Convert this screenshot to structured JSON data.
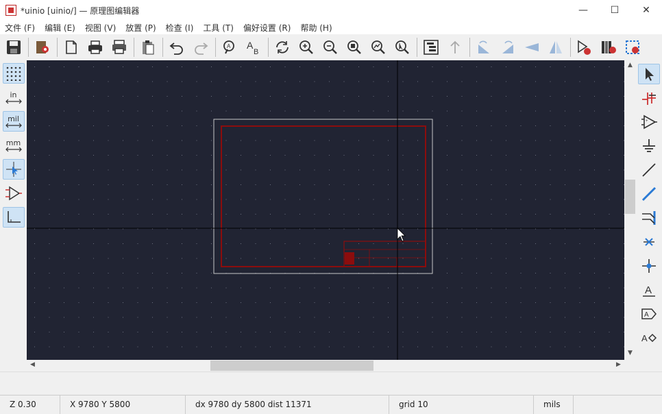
{
  "window": {
    "title": "*uinio [uinio/] — 原理图编辑器",
    "minimize_symbol": "—",
    "maximize_symbol": "☐",
    "close_symbol": "✕"
  },
  "menu": [
    "文件 (F)",
    "编辑 (E)",
    "视图 (V)",
    "放置 (P)",
    "检查 (I)",
    "工具 (T)",
    "偏好设置 (R)",
    "帮助 (H)"
  ],
  "toolbar": {
    "icons": [
      "save-icon",
      "schematic-setup-icon",
      "page-settings-icon",
      "print-icon",
      "plot-icon",
      "paste-icon",
      "undo-icon",
      "redo-icon",
      "find-icon",
      "find-replace-icon",
      "refresh-icon",
      "zoom-in-icon",
      "zoom-out-icon",
      "zoom-fit-icon",
      "zoom-objects-icon",
      "zoom-selection-icon",
      "hierarchy-navigator-icon",
      "leave-sheet-icon",
      "rotate-ccw-icon",
      "rotate-cw-icon",
      "mirror-vertical-icon",
      "mirror-horizontal-icon",
      "symbol-editor-icon",
      "symbol-browser-icon",
      "annotate-icon"
    ]
  },
  "left_toolbar": {
    "units": {
      "inches": "in",
      "mils": "mil",
      "millimeters": "mm"
    }
  },
  "canvas": {
    "background": "#212433",
    "grid_dot_color": "#6c7080",
    "sheet_color": "#8c0d0d",
    "page_border_color": "#c8c8c8",
    "crosshair_color": "#000000"
  },
  "status": {
    "zoom": "Z 0.30",
    "xy": "X 9780  Y 5800",
    "delta": "dx 9780  dy 5800  dist 11371",
    "grid": "grid 10",
    "units": "mils"
  },
  "scroll": {
    "up": "▲",
    "down": "▼",
    "left": "◀",
    "right": "▶"
  }
}
